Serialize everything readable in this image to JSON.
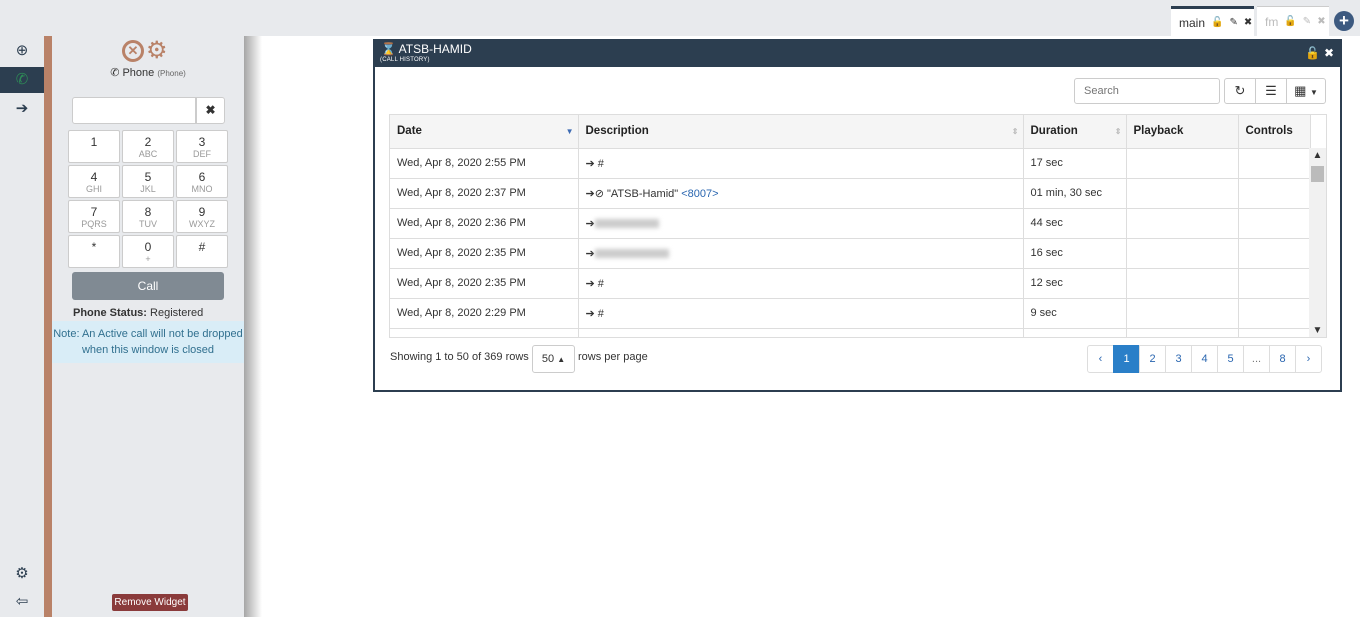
{
  "tabs": [
    {
      "label": "main"
    },
    {
      "label": "fm"
    }
  ],
  "phone": {
    "title": "Phone",
    "subtitle": "(Phone)",
    "clear": "✖",
    "keys": [
      {
        "d": "1",
        "l": ""
      },
      {
        "d": "2",
        "l": "ABC"
      },
      {
        "d": "3",
        "l": "DEF"
      },
      {
        "d": "4",
        "l": "GHI"
      },
      {
        "d": "5",
        "l": "JKL"
      },
      {
        "d": "6",
        "l": "MNO"
      },
      {
        "d": "7",
        "l": "PQRS"
      },
      {
        "d": "8",
        "l": "TUV"
      },
      {
        "d": "9",
        "l": "WXYZ"
      },
      {
        "d": "*",
        "l": ""
      },
      {
        "d": "0",
        "l": "+"
      },
      {
        "d": "#",
        "l": ""
      }
    ],
    "call_label": "Call",
    "status_label": "Phone Status:",
    "status_value": "Registered",
    "note": "Note: An Active call will not be dropped when this window is closed",
    "remove_widget": "Remove Widget"
  },
  "history": {
    "title": "ATSB-HAMID",
    "subtitle": "(CALL HISTORY)",
    "search_placeholder": "Search",
    "columns": [
      "Date",
      "Description",
      "Duration",
      "Playback",
      "Controls"
    ],
    "rows": [
      {
        "date": "Wed, Apr 8, 2020 2:55 PM",
        "desc": "#",
        "duration": "17 sec"
      },
      {
        "date": "Wed, Apr 8, 2020 2:37 PM",
        "desc": "\"ATSB-Hamid\"",
        "ext": "<8007>",
        "duration": "01 min, 30 sec"
      },
      {
        "date": "Wed, Apr 8, 2020 2:36 PM",
        "desc": "",
        "duration": "44 sec"
      },
      {
        "date": "Wed, Apr 8, 2020 2:35 PM",
        "desc": "",
        "duration": "16 sec"
      },
      {
        "date": "Wed, Apr 8, 2020 2:35 PM",
        "desc": "#",
        "duration": "12 sec"
      },
      {
        "date": "Wed, Apr 8, 2020 2:29 PM",
        "desc": "#",
        "duration": "9 sec"
      }
    ],
    "showing": "Showing 1 to 50 of 369 rows",
    "per_page": "50",
    "per_page_label": "rows per page",
    "pages": [
      "‹",
      "1",
      "2",
      "3",
      "4",
      "5",
      "...",
      "8",
      "›"
    ],
    "active_page": "1"
  },
  "colors": {
    "dark": "#2c3e50",
    "accent": "#b98268",
    "active_page": "#2a7fc8"
  }
}
